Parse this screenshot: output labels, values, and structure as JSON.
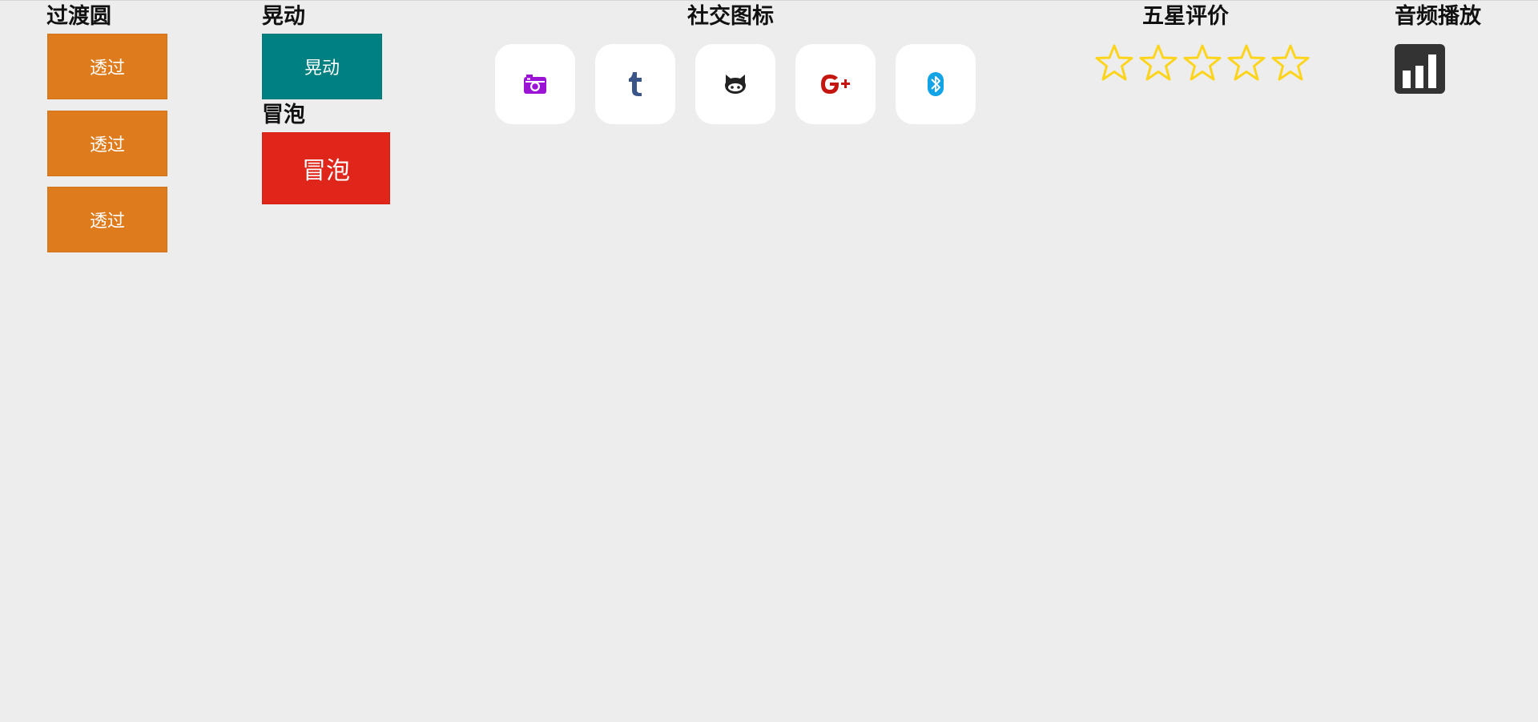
{
  "sections": {
    "transition_circle": {
      "title": "过渡圆",
      "buttons": [
        "透过",
        "透过",
        "透过"
      ],
      "color": "#de7b1d"
    },
    "shake": {
      "title": "晃动",
      "button": "晃动",
      "color": "#008080"
    },
    "bubble": {
      "title": "冒泡",
      "button": "冒泡",
      "color": "#e0251a"
    },
    "social": {
      "title": "社交图标",
      "icons": [
        {
          "name": "instagram-icon",
          "color": "#9b14d6"
        },
        {
          "name": "tumblr-icon",
          "color": "#3b5589"
        },
        {
          "name": "github-icon",
          "color": "#222222"
        },
        {
          "name": "google-plus-icon",
          "color": "#c5150f"
        },
        {
          "name": "bluetooth-icon",
          "color": "#13a4e8"
        }
      ]
    },
    "rating": {
      "title": "五星评价",
      "max_stars": 5,
      "filled_stars": 0,
      "star_color": "#fcd41c"
    },
    "audio": {
      "title": "音频播放",
      "icon": "audio-bars-icon",
      "color": "#333333"
    }
  }
}
